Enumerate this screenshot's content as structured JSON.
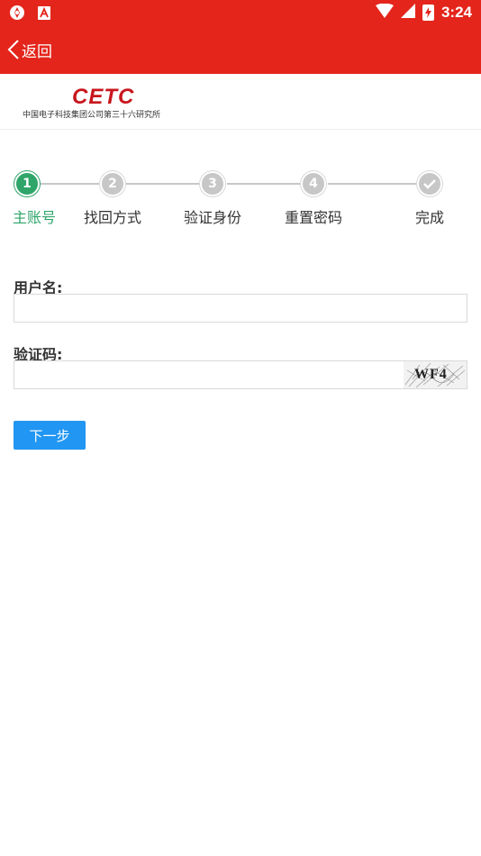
{
  "status_bar": {
    "time": "3:24",
    "icons": [
      "app-icon",
      "a-icon",
      "wifi-icon",
      "signal-icon",
      "battery-icon"
    ]
  },
  "navbar": {
    "back_label": "返回",
    "background_color": "#e4251b"
  },
  "logo": {
    "mark": "CETC",
    "subtitle": "中国电子科技集团公司第三十六研究所",
    "color": "#c8161d"
  },
  "steps": {
    "items": [
      {
        "number": "1",
        "label": "主账号",
        "active": true
      },
      {
        "number": "2",
        "label": "找回方式",
        "active": false
      },
      {
        "number": "3",
        "label": "验证身份",
        "active": false
      },
      {
        "number": "4",
        "label": "重置密码",
        "active": false
      },
      {
        "number": "",
        "label": "完成",
        "active": false
      }
    ],
    "active_color": "#2fa56a",
    "inactive_color": "#c7c7c7"
  },
  "form": {
    "username_label": "用户名:",
    "username_value": "",
    "captcha_label": "验证码:",
    "captcha_value": "",
    "captcha_image_text": "WF4"
  },
  "next_button": {
    "label": "下一步",
    "color": "#2196f3"
  }
}
